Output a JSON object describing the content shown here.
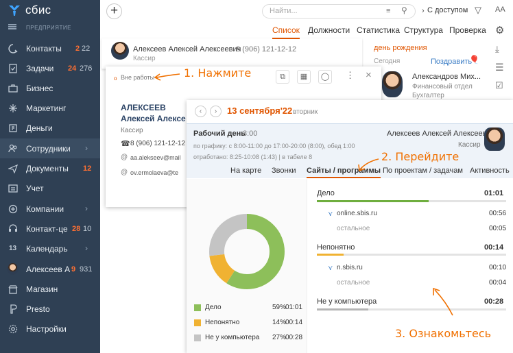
{
  "sidebar": {
    "brand": "сбис",
    "org_label": "ПРЕДПРИЯТИЕ",
    "items": [
      {
        "label": "Контакты",
        "count1": "2",
        "count2": "22",
        "icon": "contacts-icon"
      },
      {
        "label": "Задачи",
        "count1": "24",
        "count2": "276",
        "icon": "tasks-icon"
      },
      {
        "label": "Бизнес",
        "icon": "business-icon"
      },
      {
        "label": "Маркетинг",
        "icon": "marketing-icon"
      },
      {
        "label": "Деньги",
        "icon": "money-icon"
      },
      {
        "label": "Сотрудники",
        "icon": "employees-icon"
      },
      {
        "label": "Документы",
        "count1": "12",
        "icon": "documents-icon"
      },
      {
        "label": "Учет",
        "icon": "accounting-icon"
      },
      {
        "label": "Компании",
        "icon": "companies-icon"
      },
      {
        "label": "Контакт-це",
        "count1": "28",
        "count2": "10",
        "icon": "contact-center-icon"
      },
      {
        "label": "Календарь",
        "icon": "calendar-icon"
      },
      {
        "label": "Алексеев А",
        "count1": "9",
        "count2": "931",
        "icon": "user-avatar"
      },
      {
        "label": "Магазин",
        "icon": "shop-icon"
      },
      {
        "label": "Presto",
        "icon": "presto-icon"
      },
      {
        "label": "Настройки",
        "icon": "settings-icon"
      }
    ]
  },
  "topbar": {
    "search_placeholder": "Найти...",
    "access_filter": "С доступом",
    "font_button": "AA"
  },
  "tabs": [
    "Список",
    "Должности",
    "Статистика",
    "Структура",
    "Проверка"
  ],
  "list": {
    "employee_name": "Алексеев Алексей Алексеевич",
    "employee_phone": "8 (906) 121-12-12",
    "employee_role": "Кассир",
    "birthday_header": "день рождения",
    "today": "Сегодня",
    "congratulate": "Поздравить",
    "second_name": "Александров Мих...",
    "second_dept": "Финансовый отдел",
    "second_role": "Бухгалтер"
  },
  "card": {
    "status": "Вне работы",
    "last_name": "АЛЕКСЕЕВ",
    "first_name": "Алексей Алексе",
    "role": "Кассир",
    "phone": "8 (906) 121-12-12",
    "email1": "aa.alekseev@mail",
    "email2": "ov.ermolaeva@te"
  },
  "activity": {
    "date": "13 сентября'22",
    "weekday": "вторник",
    "workday_label": "Рабочий день",
    "workday_time": "8:00",
    "employee": "Алексеев Алексей Алексеевич",
    "employee_role": "Кассир",
    "schedule": "по графику: с 8:00-11:00 до 17:00-20:00 (8:00), обед 1:00",
    "worked": "отработано: 8:25-10:08 (1:43)  |  в табеле 8",
    "tabs": [
      "На карте",
      "Звонки",
      "Сайты / программы",
      "По проектам / задачам",
      "Активность"
    ],
    "groups": [
      {
        "name": "Дело",
        "total": "01:01",
        "site": "online.sbis.ru",
        "site_time": "00:56",
        "other": "остальное",
        "other_time": "00:05",
        "fill": 0.59,
        "color": "#6fae3f"
      },
      {
        "name": "Непонятно",
        "total": "00:14",
        "site": "n.sbis.ru",
        "site_time": "00:10",
        "other": "остальное",
        "other_time": "00:04",
        "fill": 0.14,
        "color": "#f0b232"
      },
      {
        "name": "Не у компьютера",
        "total": "00:28",
        "fill": 0.27,
        "color": "#b5b5b5"
      }
    ],
    "legend": [
      {
        "name": "Дело",
        "percent": "59%",
        "time": "01:01",
        "color": "#8dbf5a"
      },
      {
        "name": "Непонятно",
        "percent": "14%",
        "time": "00:14",
        "color": "#f0b232"
      },
      {
        "name": "Не у компьютера",
        "percent": "27%",
        "time": "00:28",
        "color": "#c4c4c4"
      }
    ]
  },
  "annotations": {
    "step1": "1. Нажмите",
    "step2": "2. Перейдите",
    "step3": "3. Ознакомьтесь"
  }
}
